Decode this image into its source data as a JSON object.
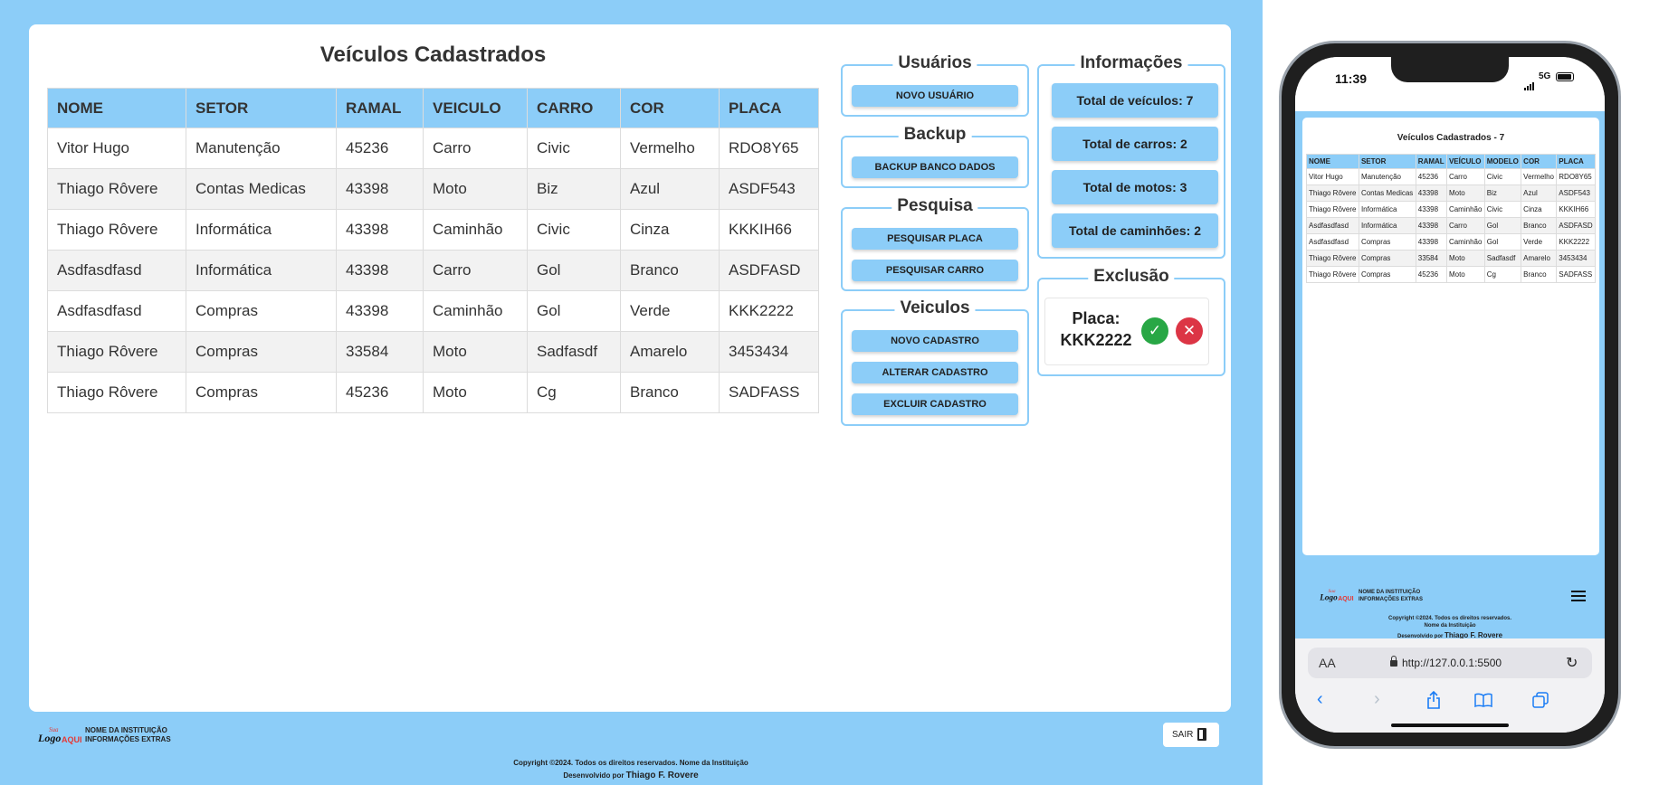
{
  "desktop": {
    "title": "Veículos Cadastrados",
    "table": {
      "headers": [
        "NOME",
        "SETOR",
        "RAMAL",
        "VEICULO",
        "CARRO",
        "COR",
        "PLACA"
      ],
      "rows": [
        [
          "Vitor Hugo",
          "Manutenção",
          "45236",
          "Carro",
          "Civic",
          "Vermelho",
          "RDO8Y65"
        ],
        [
          "Thiago Rôvere",
          "Contas Medicas",
          "43398",
          "Moto",
          "Biz",
          "Azul",
          "ASDF543"
        ],
        [
          "Thiago Rôvere",
          "Informática",
          "43398",
          "Caminhão",
          "Civic",
          "Cinza",
          "KKKIH66"
        ],
        [
          "Asdfasdfasd",
          "Informática",
          "43398",
          "Carro",
          "Gol",
          "Branco",
          "ASDFASD"
        ],
        [
          "Asdfasdfasd",
          "Compras",
          "43398",
          "Caminhão",
          "Gol",
          "Verde",
          "KKK2222"
        ],
        [
          "Thiago Rôvere",
          "Compras",
          "33584",
          "Moto",
          "Sadfasdf",
          "Amarelo",
          "3453434"
        ],
        [
          "Thiago Rôvere",
          "Compras",
          "45236",
          "Moto",
          "Cg",
          "Branco",
          "SADFASS"
        ]
      ]
    },
    "panels": {
      "usuarios": {
        "title": "Usuários",
        "buttons": [
          "NOVO USUÁRIO"
        ]
      },
      "backup": {
        "title": "Backup",
        "buttons": [
          "BACKUP BANCO DADOS"
        ]
      },
      "pesquisa": {
        "title": "Pesquisa",
        "buttons": [
          "PESQUISAR PLACA",
          "PESQUISAR CARRO"
        ]
      },
      "veiculos": {
        "title": "Veiculos",
        "buttons": [
          "NOVO CADASTRO",
          "ALTERAR CADASTRO",
          "EXCLUIR CADASTRO"
        ]
      },
      "informacoes": {
        "title": "Informações",
        "items": [
          "Total de veículos: 7",
          "Total de carros: 2",
          "Total de motos: 3",
          "Total de caminhões: 2"
        ]
      },
      "exclusao": {
        "title": "Exclusão",
        "label": "Placa:",
        "placa": "KKK2222",
        "confirm": "✓",
        "cancel": "✕"
      }
    },
    "footer": {
      "logo_line1": "Sua",
      "logo_line2": "Logo",
      "logo_line3": "AQUI",
      "inst_line1": "NOME DA INSTITUIÇÃO",
      "inst_line2": "INFORMAÇÕES EXTRAS",
      "sair": "SAIR",
      "copyright": "Copyright ©2024. Todos os direitos reservados.  Nome da Instituição",
      "dev_prefix": "Desenvolvido por",
      "dev_name": "Thiago F. Rovere"
    }
  },
  "phone": {
    "status": {
      "time": "11:39",
      "network": "5G"
    },
    "title": "Veículos Cadastrados - 7",
    "table": {
      "headers": [
        "NOME",
        "SETOR",
        "RAMAL",
        "VEÍCULO",
        "MODELO",
        "COR",
        "PLACA"
      ],
      "rows": [
        [
          "Vitor Hugo",
          "Manutenção",
          "45236",
          "Carro",
          "Civic",
          "Vermelho",
          "RDO8Y65"
        ],
        [
          "Thiago Rôvere",
          "Contas Medicas",
          "43398",
          "Moto",
          "Biz",
          "Azul",
          "ASDF543"
        ],
        [
          "Thiago Rôvere",
          "Informática",
          "43398",
          "Caminhão",
          "Civic",
          "Cinza",
          "KKKIH66"
        ],
        [
          "Asdfasdfasd",
          "Informática",
          "43398",
          "Carro",
          "Gol",
          "Branco",
          "ASDFASD"
        ],
        [
          "Asdfasdfasd",
          "Compras",
          "43398",
          "Caminhão",
          "Gol",
          "Verde",
          "KKK2222"
        ],
        [
          "Thiago Rôvere",
          "Compras",
          "33584",
          "Moto",
          "Sadfasdf",
          "Amarelo",
          "3453434"
        ],
        [
          "Thiago Rôvere",
          "Compras",
          "45236",
          "Moto",
          "Cg",
          "Branco",
          "SADFASS"
        ]
      ]
    },
    "footer": {
      "inst_line1": "NOME DA INSTITUIÇÃO",
      "inst_line2": "INFORMAÇÕES EXTRAS",
      "copyright": "Copyright ©2024. Todos os direitos reservados.",
      "inst_name": "Nome da Instituição",
      "dev_prefix": "Desenvolvido por",
      "dev_name": "Thiago F. Rovere"
    },
    "browser": {
      "aa": "AA",
      "url": "http://127.0.0.1:5500",
      "reload": "↻",
      "back": "‹",
      "forward": "›"
    }
  },
  "colors": {
    "accent": "#8ccdf8",
    "confirm": "#28a745",
    "cancel": "#dc3545",
    "safari_link": "#1a7cf5"
  }
}
